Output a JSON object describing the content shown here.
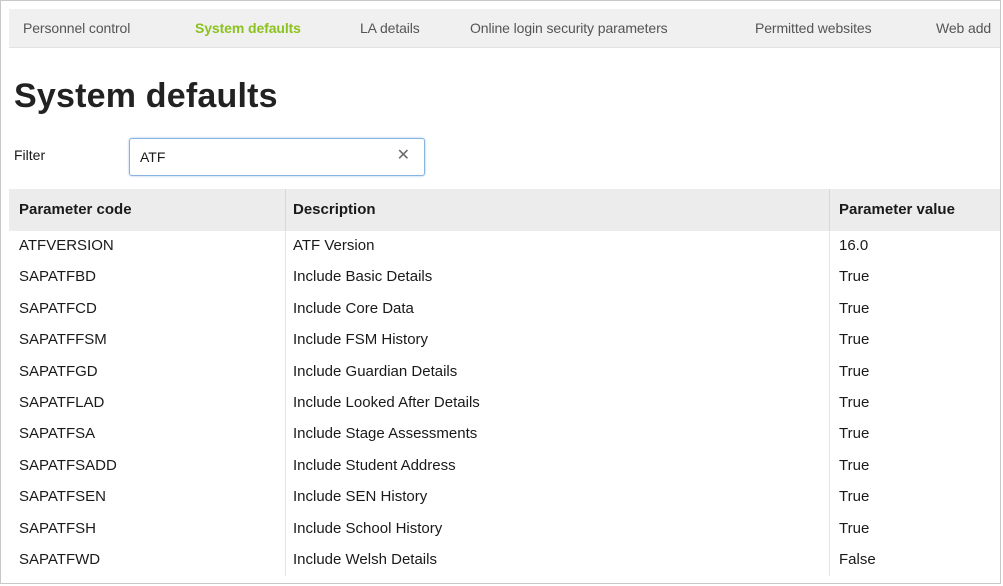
{
  "tabs": [
    {
      "label": "Personnel control",
      "active": false
    },
    {
      "label": "System defaults",
      "active": true
    },
    {
      "label": "LA details",
      "active": false
    },
    {
      "label": "Online login security parameters",
      "active": false
    },
    {
      "label": "Permitted websites",
      "active": false
    },
    {
      "label": "Web add",
      "active": false
    }
  ],
  "page": {
    "title": "System defaults"
  },
  "filter": {
    "label": "Filter",
    "value": "ATF",
    "clear_icon": "close-icon"
  },
  "table": {
    "columns": [
      "Parameter code",
      "Description",
      "Parameter value"
    ],
    "rows": [
      [
        "ATFVERSION",
        "ATF Version",
        "16.0"
      ],
      [
        "SAPATFBD",
        "Include Basic Details",
        "True"
      ],
      [
        "SAPATFCD",
        "Include Core Data",
        "True"
      ],
      [
        "SAPATFFSM",
        "Include FSM History",
        "True"
      ],
      [
        "SAPATFGD",
        "Include Guardian Details",
        "True"
      ],
      [
        "SAPATFLAD",
        "Include Looked After Details",
        "True"
      ],
      [
        "SAPATFSA",
        "Include Stage Assessments",
        "True"
      ],
      [
        "SAPATFSADD",
        "Include Student Address",
        "True"
      ],
      [
        "SAPATFSEN",
        "Include SEN History",
        "True"
      ],
      [
        "SAPATFSH",
        "Include School History",
        "True"
      ],
      [
        "SAPATFWD",
        "Include Welsh Details",
        "False"
      ]
    ]
  },
  "colors": {
    "active_tab": "#8cc21f",
    "tab_bar": "#f0f0f0",
    "header_bg": "#ececec",
    "filter_border": "#8ab4e0"
  }
}
